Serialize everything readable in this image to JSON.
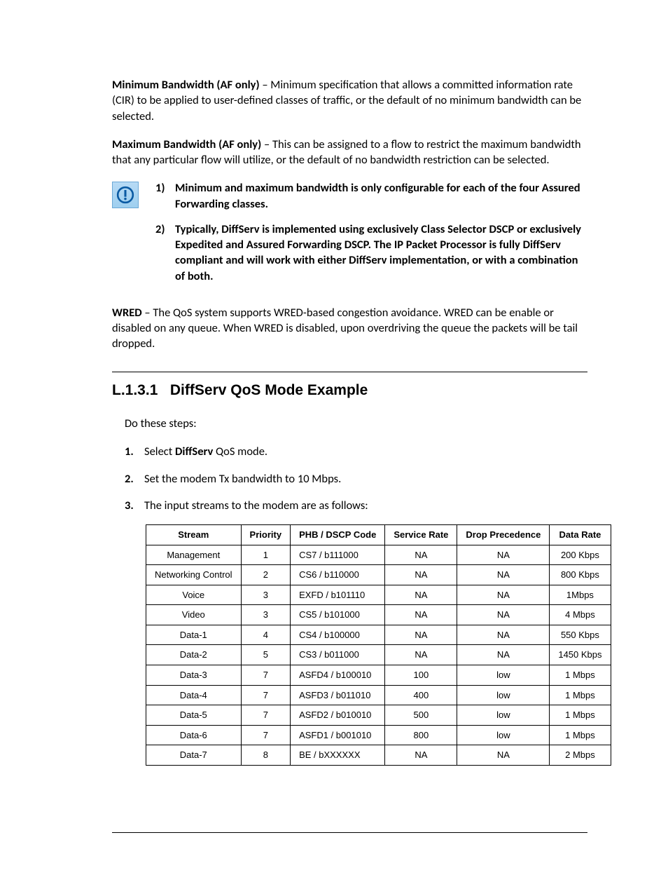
{
  "para_minbw_label": "Minimum Bandwidth (AF only)",
  "para_minbw_text": " – Minimum specification that allows a committed information rate (CIR) to be applied to user-defined classes of traffic, or the default of no minimum bandwidth can be selected.",
  "para_maxbw_label": "Maximum Bandwidth (AF only)",
  "para_maxbw_text": " – This can be assigned to a flow to restrict the maximum bandwidth that any particular flow will utilize, or the default of no bandwidth restriction can be selected.",
  "note_items": [
    {
      "num": "1)",
      "text": "Minimum and maximum bandwidth is only configurable for each of the four Assured Forwarding classes."
    },
    {
      "num": "2)",
      "text": "Typically, DiffServ is implemented using exclusively Class Selector DSCP or exclusively Expedited and Assured Forwarding DSCP. The IP Packet Processor is fully DiffServ compliant and will work with either DiffServ implementation, or with a combination of both."
    }
  ],
  "para_wred_label": "WRED",
  "para_wred_text": " – The QoS system supports WRED-based congestion avoidance. WRED can be enable or disabled on any queue. When WRED is disabled, upon overdriving the queue the packets will be tail dropped.",
  "section_number": "L.1.3.1",
  "section_title": "DiffServ QoS Mode Example",
  "steps_intro": "Do these steps:",
  "steps": [
    {
      "num": "1.",
      "before": "Select ",
      "bold": "DiffServ",
      "after": " QoS mode."
    },
    {
      "num": "2.",
      "before": "Set the modem Tx bandwidth to 10 Mbps.",
      "bold": "",
      "after": ""
    },
    {
      "num": "3.",
      "before": "The input streams to the modem are as follows:",
      "bold": "",
      "after": ""
    }
  ],
  "table_headers": [
    "Stream",
    "Priority",
    "PHB / DSCP Code",
    "Service Rate",
    "Drop Precedence",
    "Data Rate"
  ],
  "table_rows": [
    [
      "Management",
      "1",
      "CS7 / b111000",
      "NA",
      "NA",
      "200 Kbps"
    ],
    [
      "Networking Control",
      "2",
      "CS6 / b110000",
      "NA",
      "NA",
      "800 Kbps"
    ],
    [
      "Voice",
      "3",
      "EXFD / b101110",
      "NA",
      "NA",
      "1Mbps"
    ],
    [
      "Video",
      "3",
      "CS5 / b101000",
      "NA",
      "NA",
      "4 Mbps"
    ],
    [
      "Data-1",
      "4",
      "CS4 / b100000",
      "NA",
      "NA",
      "550 Kbps"
    ],
    [
      "Data-2",
      "5",
      "CS3 / b011000",
      "NA",
      "NA",
      "1450 Kbps"
    ],
    [
      "Data-3",
      "7",
      "ASFD4 / b100010",
      "100",
      "low",
      "1 Mbps"
    ],
    [
      "Data-4",
      "7",
      "ASFD3 / b011010",
      "400",
      "low",
      "1 Mbps"
    ],
    [
      "Data-5",
      "7",
      "ASFD2 / b010010",
      "500",
      "low",
      "1 Mbps"
    ],
    [
      "Data-6",
      "7",
      "ASFD1 / b001010",
      "800",
      "low",
      "1 Mbps"
    ],
    [
      "Data-7",
      "8",
      "BE / bXXXXXX",
      "NA",
      "NA",
      "2 Mbps"
    ]
  ]
}
